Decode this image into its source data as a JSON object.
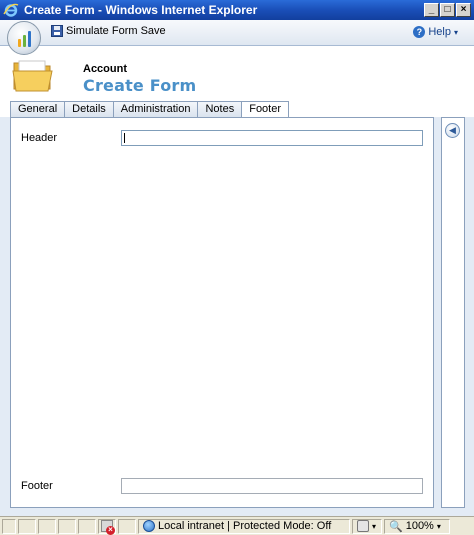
{
  "window": {
    "title": "Create Form - Windows Internet Explorer",
    "minimize": "_",
    "maximize": "□",
    "close": "×"
  },
  "toolbar": {
    "save_label": "Simulate Form Save",
    "help_label": "Help",
    "help_glyph": "?",
    "help_caret": "▾"
  },
  "header": {
    "entity": "Account",
    "form_title": "Create Form"
  },
  "tabs": [
    {
      "label": "General",
      "active": false
    },
    {
      "label": "Details",
      "active": false
    },
    {
      "label": "Administration",
      "active": false
    },
    {
      "label": "Notes",
      "active": false
    },
    {
      "label": "Footer",
      "active": true
    }
  ],
  "form": {
    "header_label": "Header",
    "header_value": "",
    "footer_label": "Footer",
    "footer_value": ""
  },
  "side_pane": {
    "collapse_glyph": "◀"
  },
  "statusbar": {
    "zone_text": "Local intranet | Protected Mode: Off",
    "zoom_text": "100%",
    "caret": "▾",
    "zoom_glyph": "🔍"
  },
  "colors": {
    "title_bar": "#1a4fb8",
    "form_title": "#4a90c8",
    "content_bg": "#e3ebf5",
    "panel_border": "#8ba0bc"
  }
}
